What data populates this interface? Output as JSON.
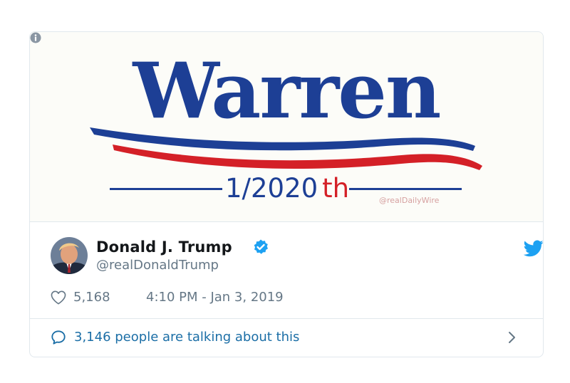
{
  "media": {
    "headline": "Warren",
    "subline": "1/2020",
    "subline_suffix": "th",
    "watermark": "@realDailyWire",
    "colors": {
      "blue": "#1d3f95",
      "red": "#d42027"
    }
  },
  "tweet": {
    "author_name": "Donald J. Trump",
    "handle": "@realDonaldTrump",
    "likes": "5,168",
    "timestamp": "4:10 PM - Jan 3, 2019",
    "talking": "3,146 people are talking about this"
  },
  "icons": {
    "info": "info-icon",
    "verified": "verified-badge-icon",
    "brand": "twitter-bird-icon",
    "like": "heart-icon",
    "reply": "speech-bubble-icon",
    "more": "chevron-right-icon"
  },
  "colors": {
    "twitter_blue": "#1da1f2",
    "link_blue": "#1b6ea6",
    "muted_text": "#657786"
  }
}
